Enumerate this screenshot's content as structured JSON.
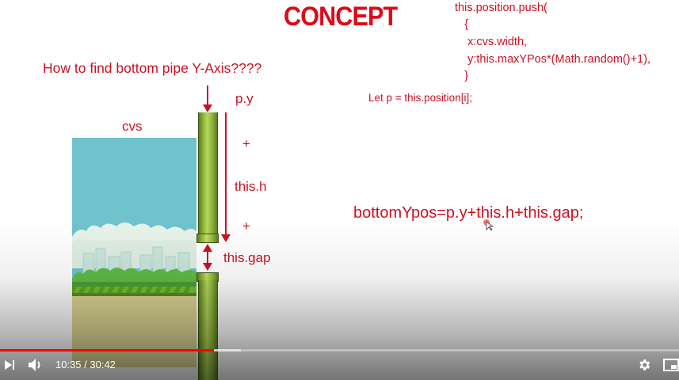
{
  "slide": {
    "title": "CONCEPT",
    "code_lines": [
      "this.position.push(",
      "   {",
      "    x:cvs.width,",
      "    y:this.maxYPos*(Math.random()+1),",
      "   }"
    ],
    "code_let": "Let p = this.position[i];",
    "question": "How to find bottom pipe Y-Axis????",
    "label_py": "p.y",
    "label_cvs": "cvs",
    "plus_1": "+",
    "label_h": "this.h",
    "plus_2": "+",
    "label_gap": "this.gap",
    "formula": "bottomYpos=p.y+this.h+this.gap;",
    "accent_color": "#cc1122"
  },
  "player": {
    "progress_fraction": 0.3392,
    "buffer_fraction": 0.355,
    "time_text": "10:35 / 30:42",
    "icons": {
      "play": "play-icon",
      "volume": "volume-icon",
      "settings": "gear-icon",
      "miniplayer": "miniplayer-icon"
    }
  }
}
